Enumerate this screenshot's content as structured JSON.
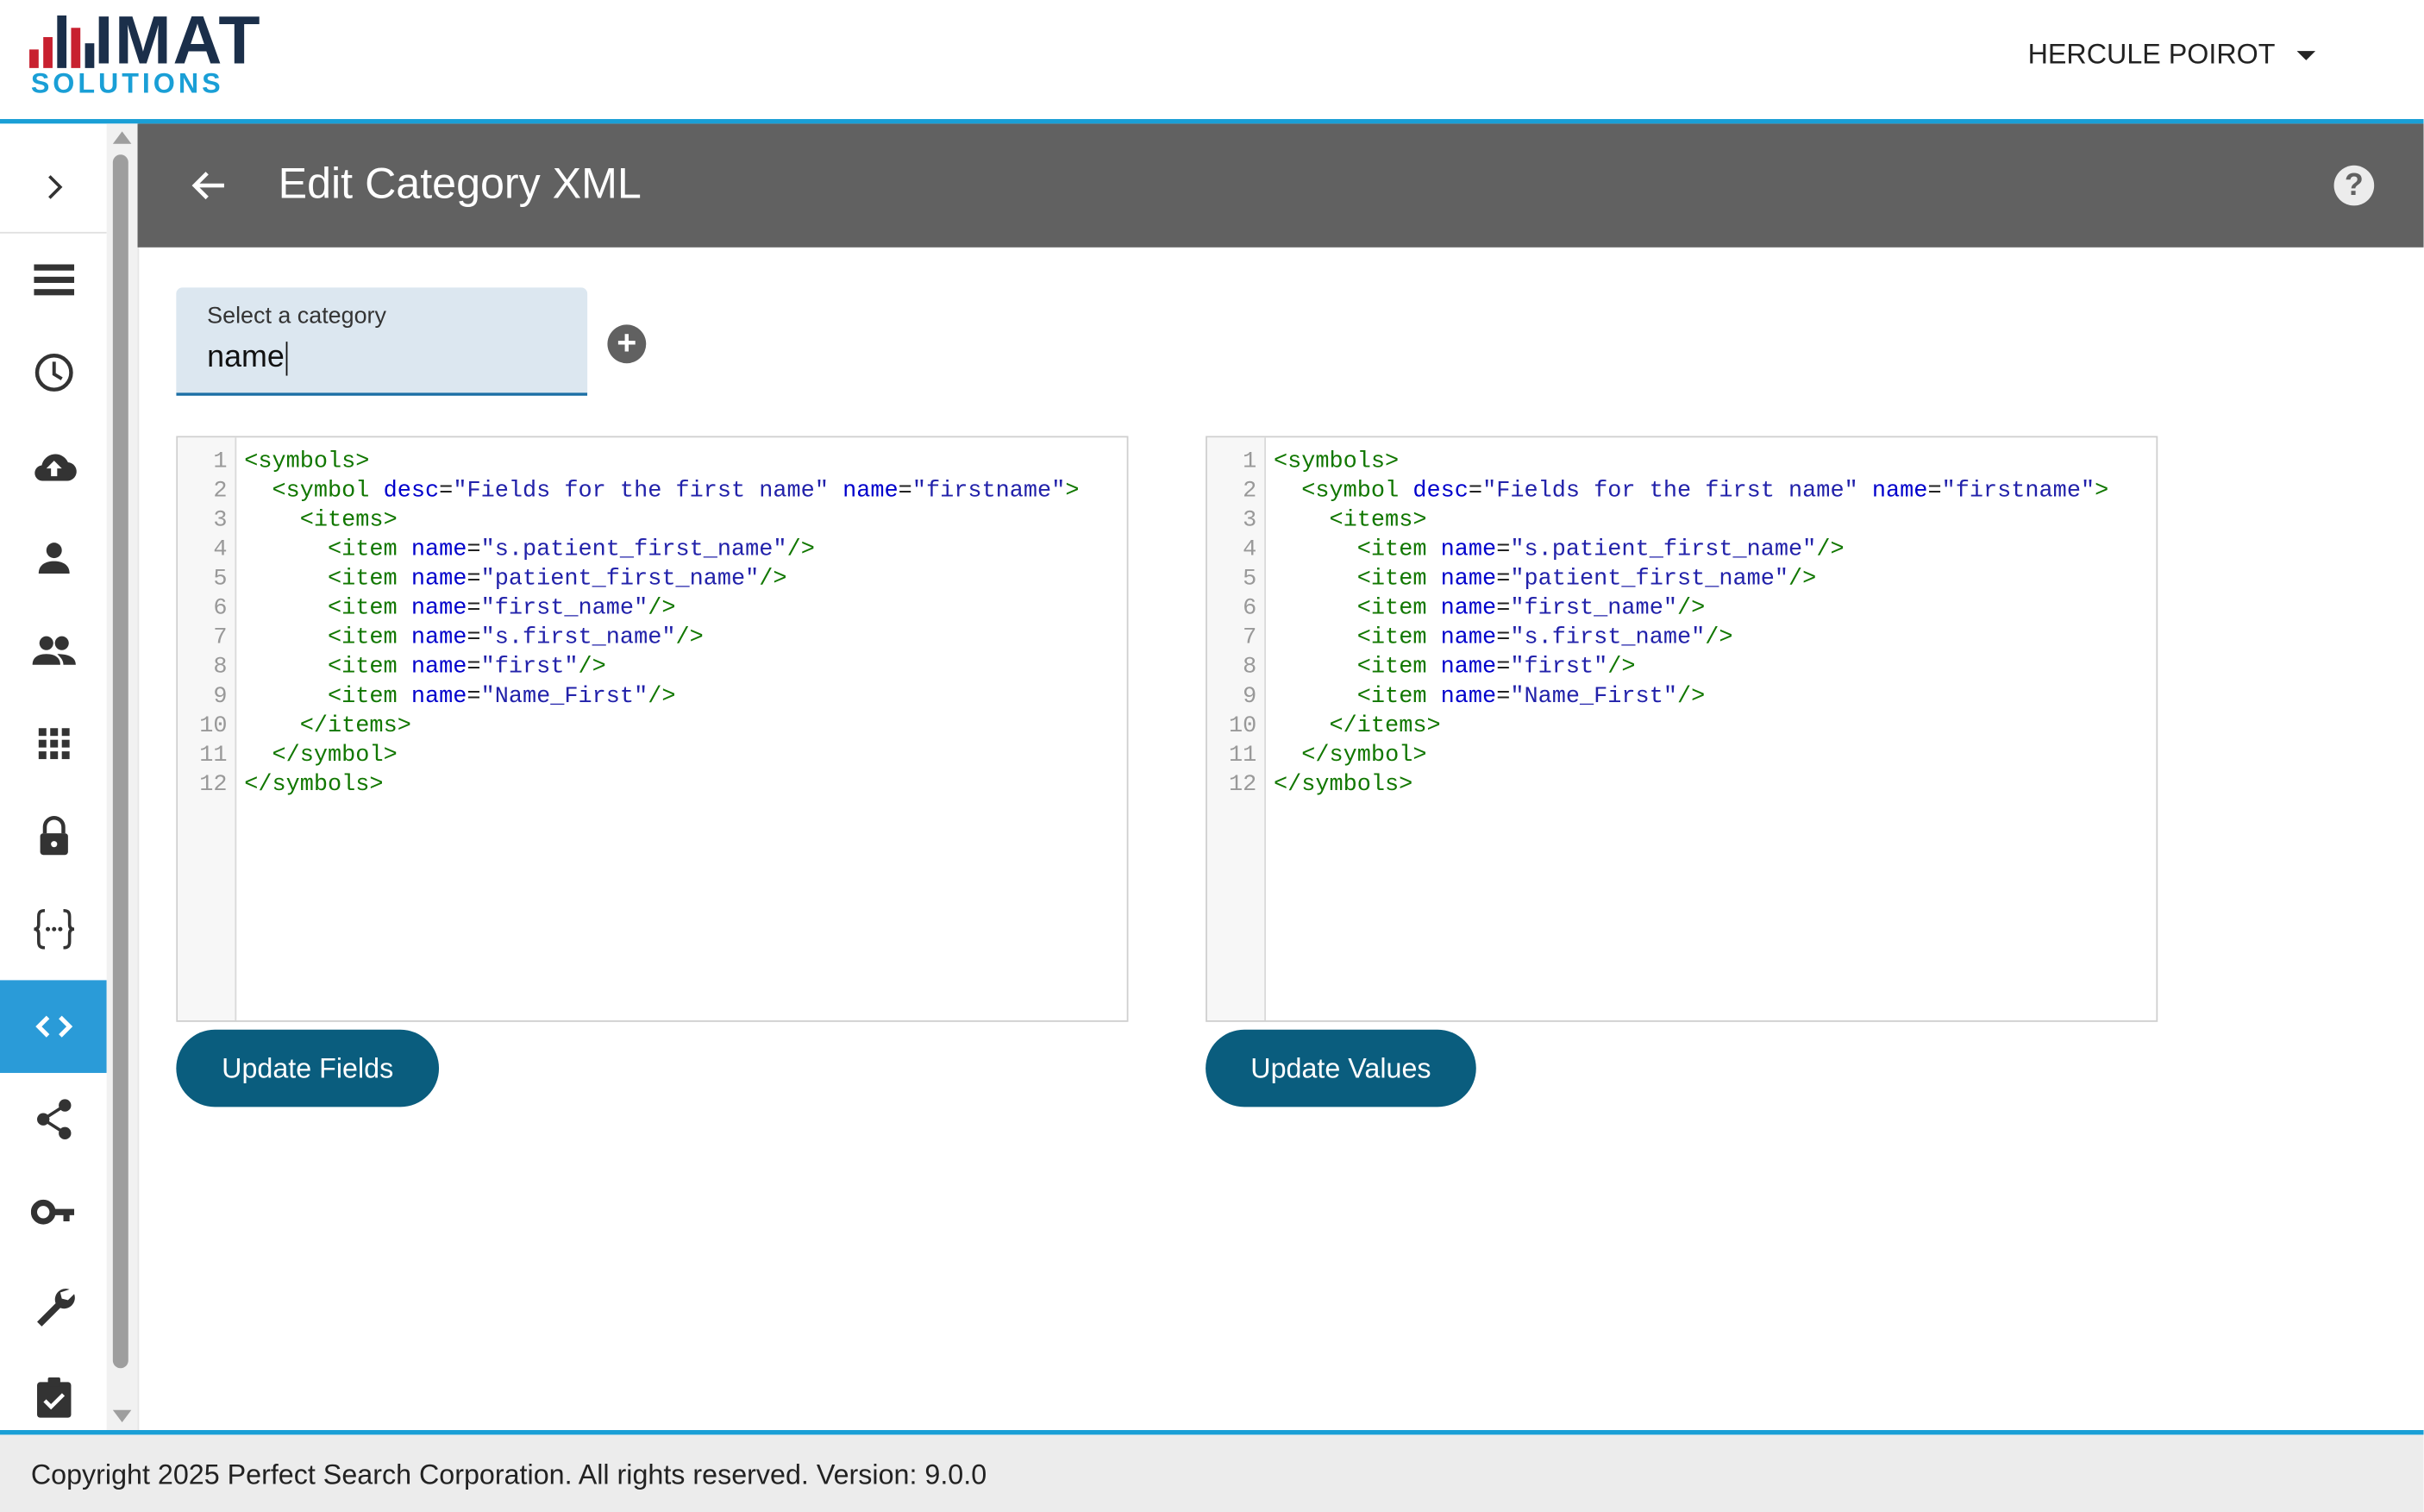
{
  "header": {
    "logo_main": "IMAT",
    "logo_sub": "SOLUTIONS",
    "user_name": "HERCULE POIROT"
  },
  "sidebar": {
    "items": [
      {
        "icon": "chevron-right-icon",
        "active": false
      },
      {
        "icon": "list-icon",
        "active": false
      },
      {
        "icon": "clock-icon",
        "active": false
      },
      {
        "icon": "cloud-upload-icon",
        "active": false
      },
      {
        "icon": "person-icon",
        "active": false
      },
      {
        "icon": "people-icon",
        "active": false
      },
      {
        "icon": "apps-grid-icon",
        "active": false
      },
      {
        "icon": "lock-icon",
        "active": false
      },
      {
        "icon": "curly-braces-icon",
        "active": false
      },
      {
        "icon": "code-icon",
        "active": true
      },
      {
        "icon": "share-icon",
        "active": false
      },
      {
        "icon": "key-icon",
        "active": false
      },
      {
        "icon": "wrench-icon",
        "active": false
      },
      {
        "icon": "assignment-check-icon",
        "active": false
      }
    ],
    "active_color": "#2a9bd8"
  },
  "page": {
    "title": "Edit Category XML",
    "help_label": "?"
  },
  "category": {
    "label": "Select a category",
    "value": "name",
    "add_label": "+"
  },
  "editor_left": {
    "lines": [
      "<symbols>",
      "  <symbol desc=\"Fields for the first name\" name=\"firstname\">",
      "    <items>",
      "      <item name=\"s.patient_first_name\"/>",
      "      <item name=\"patient_first_name\"/>",
      "      <item name=\"first_name\"/>",
      "      <item name=\"s.first_name\"/>",
      "      <item name=\"first\"/>",
      "      <item name=\"Name_First\"/>",
      "    </items>",
      "  </symbol>",
      "</symbols>"
    ]
  },
  "editor_right": {
    "lines": [
      "<symbols>",
      "  <symbol desc=\"Fields for the first name\" name=\"firstname\">",
      "    <items>",
      "      <item name=\"s.patient_first_name\"/>",
      "      <item name=\"patient_first_name\"/>",
      "      <item name=\"first_name\"/>",
      "      <item name=\"s.first_name\"/>",
      "      <item name=\"first\"/>",
      "      <item name=\"Name_First\"/>",
      "    </items>",
      "  </symbol>",
      "</symbols>"
    ]
  },
  "buttons": {
    "update_fields": "Update Fields",
    "update_values": "Update Values"
  },
  "footer": {
    "text": "Copyright 2025 Perfect Search Corporation. All rights reserved. Version: 9.0.0"
  },
  "colors": {
    "header_rule": "#1a9fd6",
    "page_bar": "#616161",
    "button": "#0a5d7e",
    "logo_dark": "#1b2f4a",
    "logo_red": "#c8202f"
  }
}
